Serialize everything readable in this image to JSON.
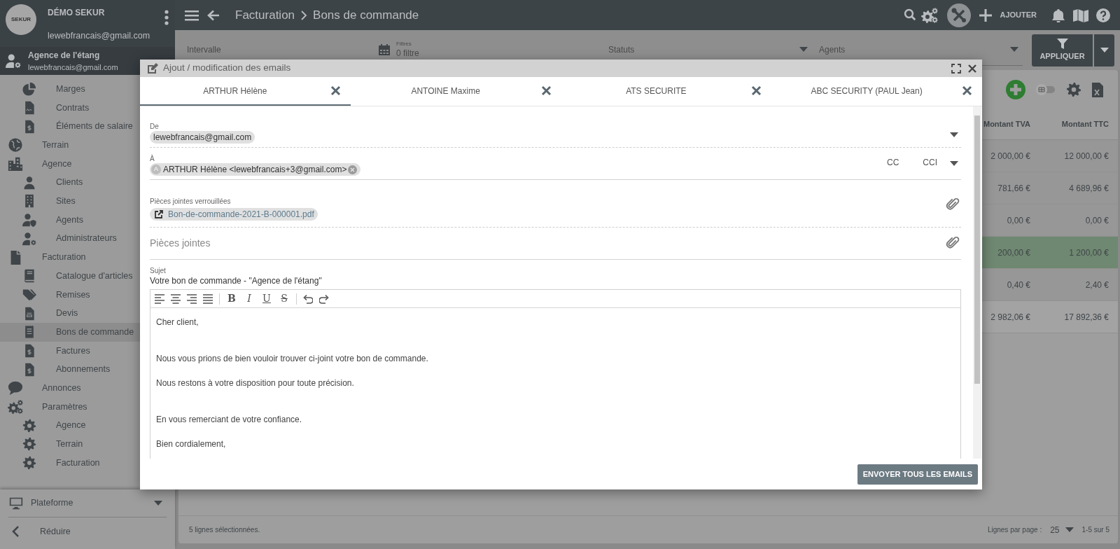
{
  "sidebar": {
    "logo": {
      "text": "SEKUR"
    },
    "account": {
      "name": "DÉMO SEKUR",
      "email": "lewebfrancais@gmail.com"
    },
    "agency": {
      "name": "Agence de l'étang",
      "email": "lewebfrancais@gmail.com"
    },
    "items": [
      {
        "children": [
          {
            "label": "Marges",
            "selected": false
          },
          {
            "label": "Contrats",
            "selected": false
          },
          {
            "label": "Éléments de salaire",
            "selected": false
          }
        ]
      },
      {
        "label": "Terrain",
        "selected": false
      },
      {
        "label": "Agence",
        "selected": false,
        "children": [
          {
            "label": "Clients",
            "selected": false
          },
          {
            "label": "Sites",
            "selected": false
          },
          {
            "label": "Agents",
            "selected": false
          },
          {
            "label": "Administrateurs",
            "selected": false
          }
        ]
      },
      {
        "label": "Facturation",
        "selected": false,
        "children": [
          {
            "label": "Catalogue d'articles",
            "selected": false
          },
          {
            "label": "Remises",
            "selected": false
          },
          {
            "label": "Devis",
            "selected": false
          },
          {
            "label": "Bons de commande",
            "selected": true
          },
          {
            "label": "Factures",
            "selected": false
          },
          {
            "label": "Abonnements",
            "selected": false
          }
        ]
      },
      {
        "label": "Annonces",
        "selected": false
      },
      {
        "label": "Paramètres",
        "selected": false,
        "children": [
          {
            "label": "Agence",
            "selected": false
          },
          {
            "label": "Terrain",
            "selected": false
          },
          {
            "label": "Facturation",
            "selected": false
          }
        ]
      }
    ],
    "platform": {
      "label": "Plateforme"
    },
    "collapse": {
      "label": "Réduire"
    }
  },
  "topbar": {
    "breadcrumb": [
      "Facturation",
      "Bons de commande"
    ],
    "add_label": "AJOUTER"
  },
  "filters": {
    "fields": [
      {
        "kind": "text",
        "label": "Intervalle"
      },
      {
        "kind": "date",
        "label": "Filtres",
        "value": "0 filtre"
      },
      {
        "kind": "select",
        "label": "Statuts"
      },
      {
        "kind": "select",
        "label": "Agents"
      }
    ],
    "apply": "APPLIQUER"
  },
  "view_toggle": {
    "on": false
  },
  "table": {
    "columns": [
      "Montant TVA",
      "Montant TTC"
    ],
    "rows": [
      {
        "cells": [
          "2 000,00 €",
          "12 000,00 €"
        ],
        "highlighted": false
      },
      {
        "cells": [
          "781,66 €",
          "4 689,96 €"
        ],
        "highlighted": false
      },
      {
        "cells": [
          "0,00 €",
          "0,00 €"
        ],
        "highlighted": false
      },
      {
        "cells": [
          "200,00 €",
          "1 200,00 €"
        ],
        "highlighted": true
      },
      {
        "cells": [
          "0,40 €",
          "2,40 €"
        ],
        "highlighted": false
      }
    ],
    "total": [
      "2 982,06 €",
      "17 892,36 €"
    ]
  },
  "footer": {
    "selection": "5 lignes sélectionnées.",
    "per_page_label": "Lignes par page :",
    "per_page": "25",
    "range": "1-5 sur 5"
  },
  "modal": {
    "title": "Ajout / modification des emails",
    "tabs": [
      {
        "label": "ARTHUR Hélène",
        "selected": true
      },
      {
        "label": "ANTOINE Maxime",
        "selected": false
      },
      {
        "label": "ATS SECURITE",
        "selected": false
      },
      {
        "label": "ABC SECURITY (PAUL Jean)",
        "selected": false
      }
    ],
    "from": {
      "label": "De",
      "chip": "lewebfrancais@gmail.com"
    },
    "to": {
      "label": "À",
      "recipients": [
        {
          "avatar": "A",
          "label": "ARTHUR Hélène <lewebfrancais+3@gmail.com>"
        }
      ],
      "cc": "CC",
      "bcc": "CCI"
    },
    "locked_attachments": {
      "label": "Pièces jointes verrouillées",
      "files": [
        "Bon-de-commande-2021-B-000001.pdf"
      ]
    },
    "attachments": {
      "placeholder": "Pièces jointes"
    },
    "subject": {
      "label": "Sujet",
      "value": "Votre bon de commande - \"Agence de l'étang\""
    },
    "toolbar": [
      [
        {
          "kind": "align-left"
        },
        {
          "kind": "align-center"
        },
        {
          "kind": "align-right"
        },
        {
          "kind": "justify"
        }
      ],
      [
        {
          "kind": "bold",
          "text": "B"
        },
        {
          "kind": "italic",
          "text": "I"
        },
        {
          "kind": "underline",
          "text": "U"
        },
        {
          "kind": "strike",
          "text": "S"
        }
      ],
      [
        {
          "kind": "undo"
        },
        {
          "kind": "redo"
        }
      ]
    ],
    "body": [
      [
        "Cher client,"
      ],
      [
        "Nous vous prions de bien vouloir trouver ci-joint votre bon de commande.",
        "Nous restons à votre disposition pour toute précision."
      ],
      [
        "En vous remerciant de votre confiance.",
        "Bien cordialement,"
      ]
    ],
    "send": "ENVOYER TOUS LES EMAILS"
  }
}
